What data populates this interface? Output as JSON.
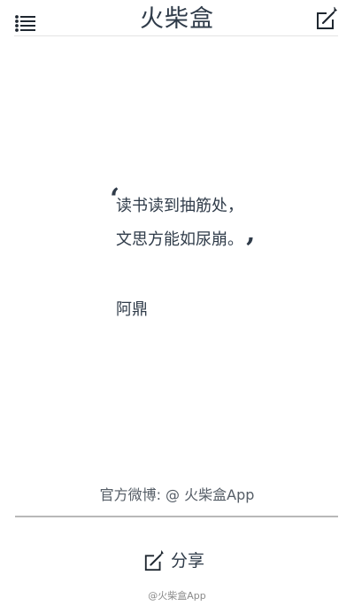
{
  "header": {
    "title": "火柴盒",
    "menu_icon": "list-menu-icon",
    "compose_icon": "compose-edit-icon"
  },
  "quote": {
    "open_mark": "‘",
    "lines": [
      "读书读到抽筋处，",
      "文思方能如尿崩。"
    ],
    "close_mark": "’",
    "author": "阿鼎"
  },
  "footer": {
    "weibo_credit": "官方微博: @ 火柴盒App",
    "share_label": "分享",
    "share_icon": "share-edit-icon",
    "watermark": "@火柴盒App"
  },
  "colors": {
    "text": "#2f3b49",
    "divider": "#b8b8b8",
    "background": "#ffffff"
  }
}
